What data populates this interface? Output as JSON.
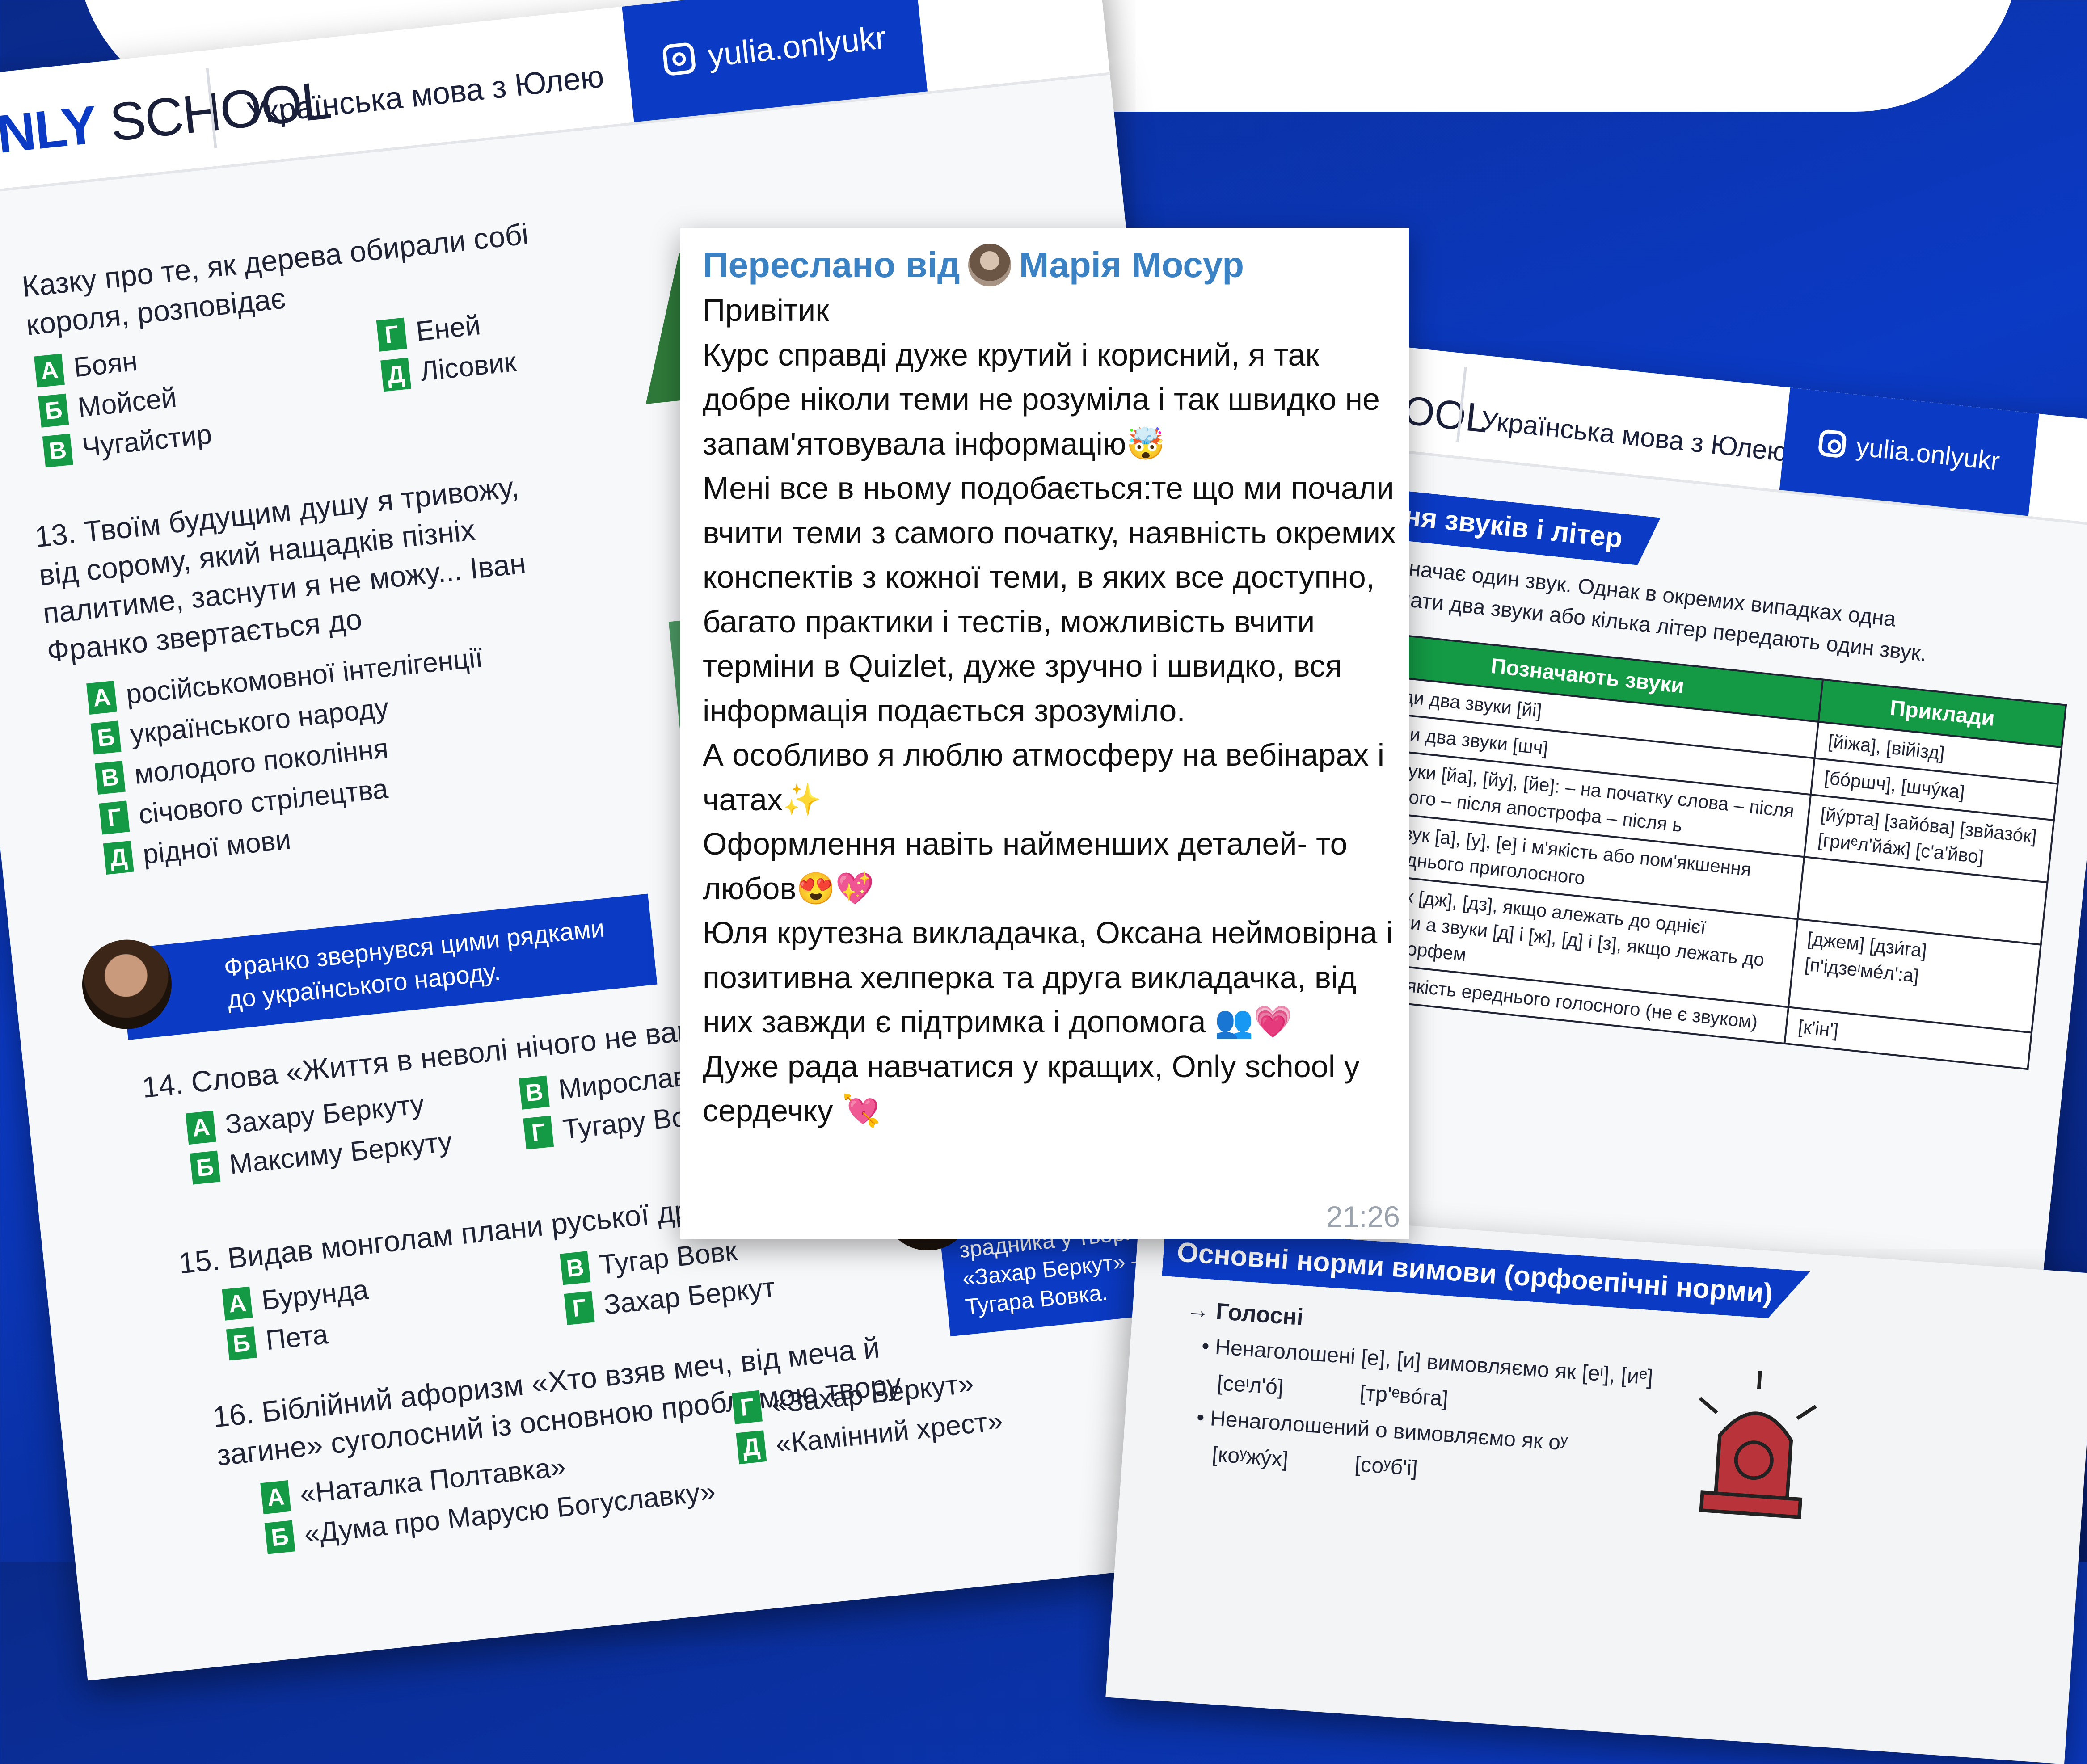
{
  "left_page": {
    "logo_left": "NLY",
    "logo_right": "SCHOOL",
    "header_title": "Українська мова з Юлею",
    "instagram": "yulia.onlyukr",
    "q12": {
      "text": "Казку про те, як дерева обирали собі короля, розповідає",
      "options": [
        {
          "l": "А",
          "t": "Боян"
        },
        {
          "l": "Б",
          "t": "Мойсей"
        },
        {
          "l": "В",
          "t": "Чугайстир"
        },
        {
          "l": "Г",
          "t": "Еней"
        },
        {
          "l": "Д",
          "t": "Лісовик"
        }
      ]
    },
    "q13": {
      "text": "13. Твоїм будущим душу я тривожу, від сорому, який нащадків пізніх палитиме, заснути я не можу... Іван Франко звертається до",
      "options": [
        {
          "l": "А",
          "t": "російськомовної інтелігенції"
        },
        {
          "l": "Б",
          "t": "українського народу"
        },
        {
          "l": "В",
          "t": "молодого покоління"
        },
        {
          "l": "Г",
          "t": "січового стрілецтва"
        },
        {
          "l": "Д",
          "t": "рідної мови"
        }
      ]
    },
    "note1": "Франко звернувся цими рядками до українського народу.",
    "q14": {
      "text": "14. Слова «Життя в неволі нічого не варте... крац",
      "options": [
        {
          "l": "А",
          "t": "Захару Беркуту"
        },
        {
          "l": "Б",
          "t": "Максиму Беркуту"
        },
        {
          "l": "В",
          "t": "Мирославі"
        },
        {
          "l": "Г",
          "t": "Тугару Вовку"
        }
      ]
    },
    "q15": {
      "text": "15. Видав монголам плани руської дружини на",
      "options": [
        {
          "l": "А",
          "t": "Бурунда"
        },
        {
          "l": "Б",
          "t": "Пета"
        },
        {
          "l": "В",
          "t": "Тугар Вовк"
        },
        {
          "l": "Г",
          "t": "Захар Беркут"
        }
      ]
    },
    "note2": "Тут йдеться про зрадника у творі «Захар Беркут» – Тугара Вовка.",
    "q16": {
      "text": "16. Біблійний афоризм «Хто взяв меч, від меча й загине» суголосний із основною проблемою твору",
      "options": [
        {
          "l": "А",
          "t": "«Наталка Полтавка»"
        },
        {
          "l": "Б",
          "t": "«Дума про Марусю Богуславку»"
        },
        {
          "l": "Г",
          "t": "«Захар Беркут»"
        },
        {
          "l": "Д",
          "t": "«Камінний хрест»"
        }
      ]
    }
  },
  "right_page": {
    "logo": "HOOL",
    "header_title": "Українська мова з Юлею",
    "instagram": "yulia.onlyukr",
    "banner": "ення звуків і літер",
    "intro_1": "о позначає один звук. Однак в окремих випадках одна",
    "intro_2": "означати два звуки або кілька літер передають один звук.",
    "table_head": [
      "Позначають звуки",
      "Приклади"
    ],
    "table_rows": [
      [
        "завжди два звуки [йі]",
        "[йіжа], [війізд]"
      ],
      [
        "завжди два звуки [шч]",
        "[бóршч], [шчýка]"
      ],
      [
        "два звуки [йа], [йу], [йе]: – на початку слова – після голосного – після апострофа – після ь",
        "[йýрта] [зайóва] [звйазóк] [гриᵉл'йáж] [с'а'йво]"
      ],
      [
        "один звук [а], [у], [е] і м'якість або пом'якшення попереднього приголосного",
        ""
      ],
      [
        "дин звук [дж], [дз], якщо алежать до однієї морфеми а звуки [д] і [ж], [д] і [з], якщо лежать до різних морфем",
        "[джем] [дзи́га] [п'ідзеᶦмéл':а]"
      ],
      [
        "зує на м'якість ереднього голосного (не є звуком)",
        "[к'ін']"
      ]
    ]
  },
  "bottom_page": {
    "banner": "Основні норми вимови (орфоепічні норми)",
    "section": "Голосні",
    "rule1": "Ненаголошені [е], [и] вимовляємо як [еᶦ], [иᵉ]",
    "ex1a": "[сеᶦл'ó]",
    "ex1b": "[тр'ᵉвóга]",
    "rule2": "Ненаголошений о вимовляємо як оʸ",
    "ex2a": "[коʸжýх]",
    "ex2b": "[соʸб'і]"
  },
  "message": {
    "forwarded_label": "Переслано від",
    "forwarded_from": "Марія Мосур",
    "text": "Привітик\nКурс справді дуже крутий і корисний, я так добре ніколи теми не розуміла і так швидко не запам'ятовувала інформацію🤯\nМені все в ньому подобається:те що ми почали вчити теми з самого початку, наявність окремих конспектів з кожної теми, в яких все доступно, багато практики і тестів, можливість вчити терміни в Quizlet, дуже зручно і швидко, вся інформація подається зрозуміло.\nА особливо я люблю атмосферу на вебінарах і чатах✨\nОформлення навіть найменших деталей- то любов😍💖\nЮля крутезна викладачка, Оксана неймовірна і позитивна хелперка та друга викладачка, від них завжди є підтримка і допомога 👥💗\nДуже рада навчатися у кращих, Only school у сердечку 💘",
    "time": "21:26"
  },
  "colors": {
    "brand_blue": "#0b3ac4",
    "accent_green": "#149a45",
    "link_blue": "#3b82c4"
  }
}
